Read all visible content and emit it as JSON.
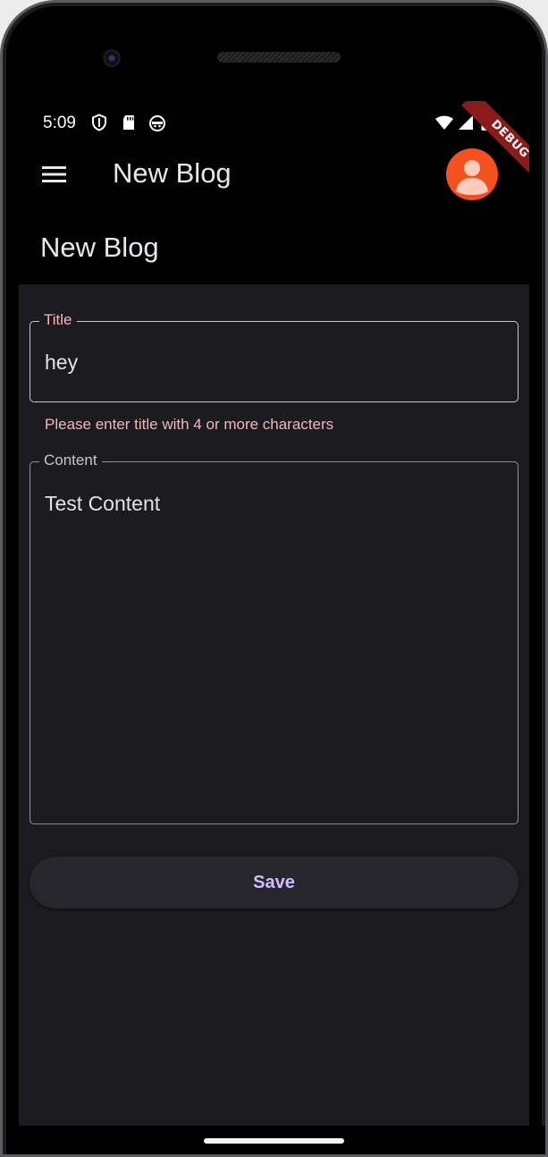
{
  "status_bar": {
    "time": "5:09",
    "left_icons": [
      "shield-icon",
      "sd-card-icon",
      "android-robot-icon"
    ],
    "right_icons": [
      "wifi-icon",
      "cellular-signal-icon",
      "battery-icon"
    ]
  },
  "app_bar": {
    "title": "New Blog",
    "menu_icon": "hamburger-menu-icon",
    "avatar_icon": "account-avatar-icon",
    "avatar_color": "#f4511e"
  },
  "debug_banner": {
    "text": "DEBUG"
  },
  "page": {
    "title": "New Blog"
  },
  "form": {
    "title_field": {
      "label": "Title",
      "value": "hey",
      "error": "Please enter title with 4 or more characters",
      "error_color": "#f2b8b5"
    },
    "content_field": {
      "label": "Content",
      "value": "Test Content"
    },
    "save_button": {
      "label": "Save",
      "color": "#d0bcff"
    }
  },
  "theme": {
    "background": "#1c1b20",
    "appbar_background": "#000000"
  }
}
